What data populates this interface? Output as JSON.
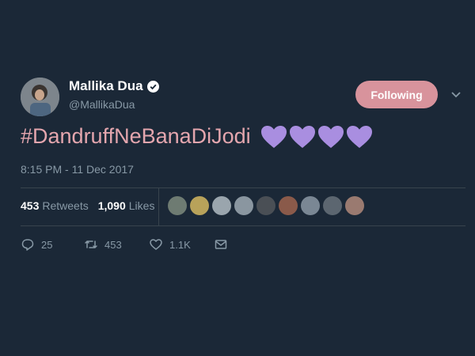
{
  "tweet": {
    "author_name": "Mallika Dua",
    "author_handle": "@MallikaDua",
    "follow_button_label": "Following",
    "text": "#DandruffNeBanaDiJodi",
    "heart_emoji_count": 4,
    "timestamp": "8:15 PM - 11 Dec 2017",
    "retweets_count": "453",
    "retweets_label": "Retweets",
    "likes_count": "1,090",
    "likes_label": "Likes",
    "liker_avatar_count": 9,
    "reply_count": "25",
    "retweet_action_count": "453",
    "like_action_count": "1.1K"
  },
  "colors": {
    "background": "#1b2837",
    "follow_button": "#d8939c",
    "hashtag_text": "#e4a6ae",
    "secondary_text": "#8899a6",
    "heart_emoji": "#a98ee0"
  },
  "icons": {
    "verified": "verified-badge-icon",
    "more": "chevron-down-icon",
    "reply": "reply-icon",
    "retweet": "retweet-icon",
    "like": "heart-outline-icon",
    "message": "envelope-icon"
  }
}
